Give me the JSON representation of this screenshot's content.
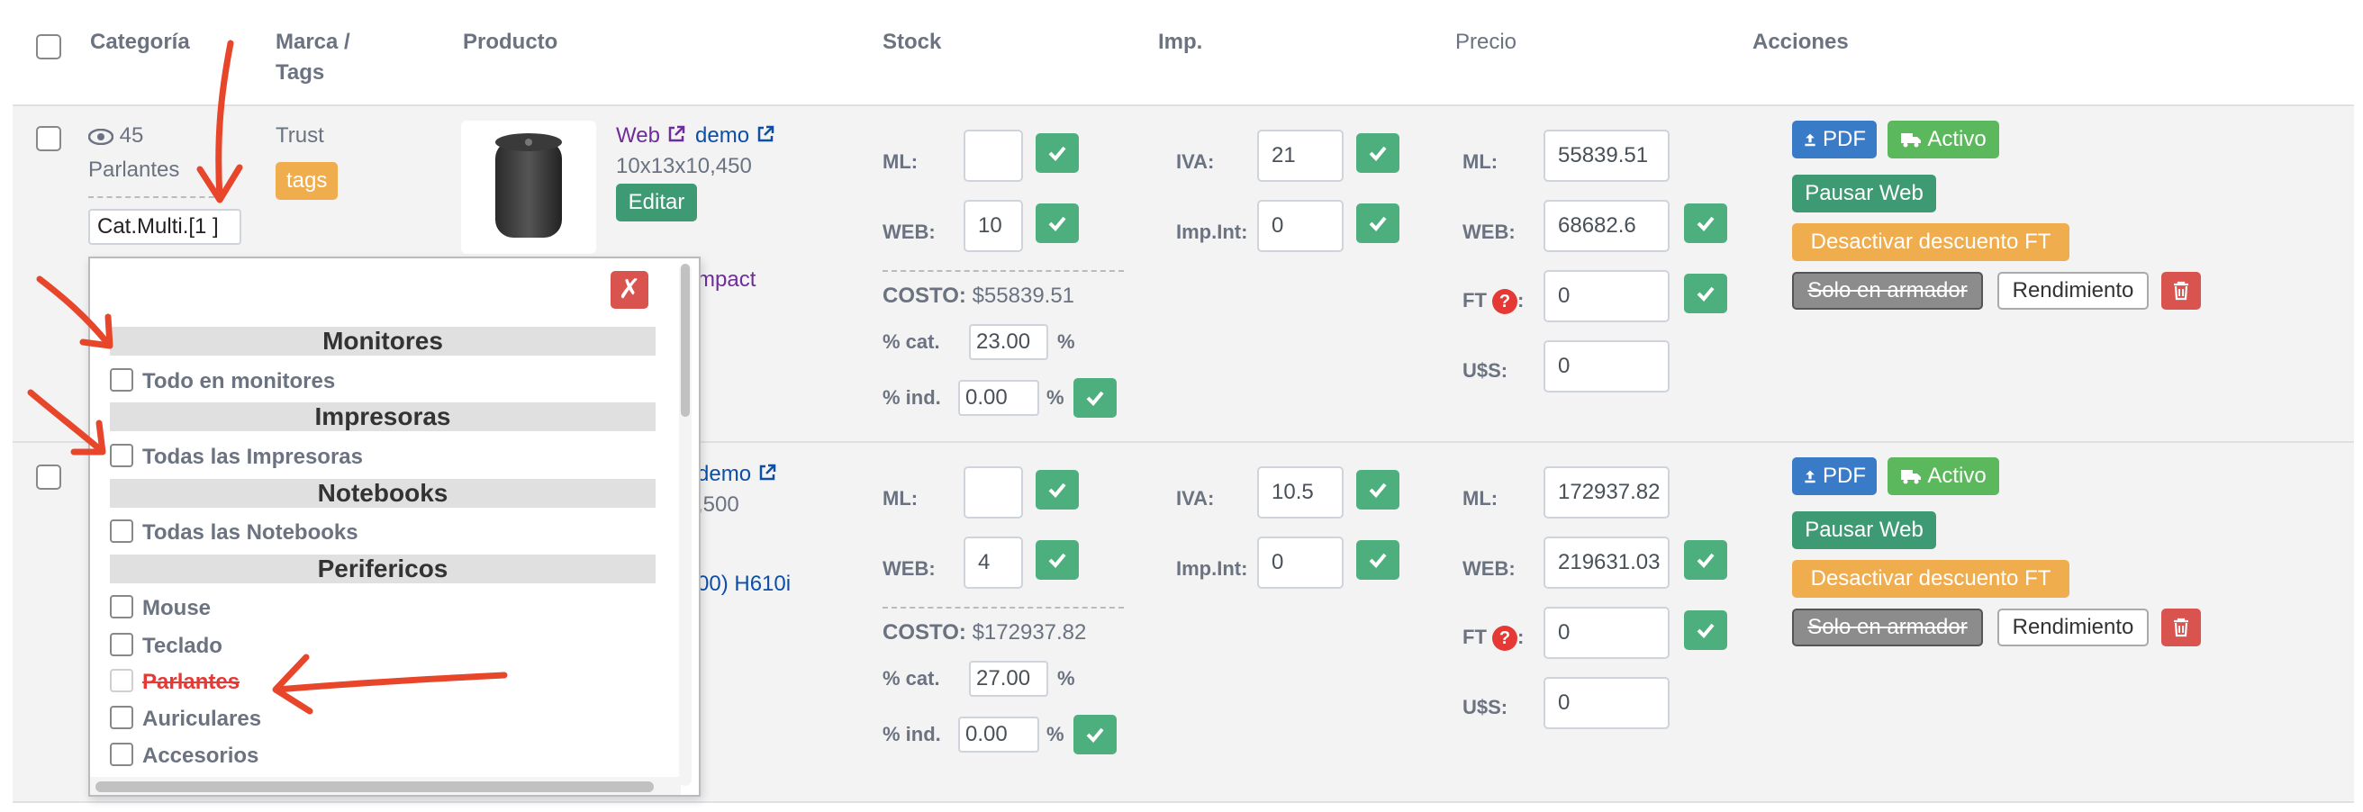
{
  "header": {
    "categoria": "Categoría",
    "marca_line1": "Marca /",
    "marca_line2": "Tags",
    "producto": "Producto",
    "stock": "Stock",
    "imp": "Imp.",
    "precio": "Precio",
    "acciones": "Acciones"
  },
  "row1": {
    "views": "45",
    "categoria": "Parlantes",
    "cat_multi": "Cat.Multi.[1 ]",
    "marca": "Trust",
    "tags_label": "tags",
    "web_link": "Web",
    "demo_link": "demo",
    "dimensiones": "10x13x10,450",
    "editar": "Editar",
    "product_name_fragment": "mpact",
    "stock": {
      "ml_label": "ML:",
      "ml_value": "",
      "web_label": "WEB:",
      "web_value": "10"
    },
    "costo_label": "COSTO:",
    "costo_value": "$55839.51",
    "pct_cat_label": "% cat.",
    "pct_cat_value": "23.00",
    "pct_ind_label": "% ind.",
    "pct_ind_value": "0.00",
    "pct_sign": "%",
    "imp": {
      "iva_label": "IVA:",
      "iva_value": "21",
      "impint_label": "Imp.Int:",
      "impint_value": "0"
    },
    "precio": {
      "ml_label": "ML:",
      "ml_value": "55839.51",
      "web_label": "WEB:",
      "web_value": "68682.6",
      "ft_label": "FT",
      "ft_value": "0",
      "uss_label": "U$S:",
      "uss_value": "0"
    }
  },
  "row2": {
    "demo_link": "demo",
    "dim_fragment": ",500",
    "product_fragment": "00) H610i",
    "stock": {
      "ml_label": "ML:",
      "ml_value": "",
      "web_label": "WEB:",
      "web_value": "4"
    },
    "costo_label": "COSTO:",
    "costo_value": "$172937.82",
    "pct_cat_label": "% cat.",
    "pct_cat_value": "27.00",
    "pct_ind_label": "% ind.",
    "pct_ind_value": "0.00",
    "pct_sign": "%",
    "imp": {
      "iva_label": "IVA:",
      "iva_value": "10.5",
      "impint_label": "Imp.Int:",
      "impint_value": "0"
    },
    "precio": {
      "ml_label": "ML:",
      "ml_value": "172937.82",
      "web_label": "WEB:",
      "web_value": "219631.03",
      "ft_label": "FT",
      "ft_value": "0",
      "uss_label": "U$S:",
      "uss_value": "0"
    }
  },
  "actions": {
    "pdf": "PDF",
    "activo": "Activo",
    "pausar_web": "Pausar Web",
    "desactivar": "Desactivar descuento FT",
    "solo_armador": "Solo en armador",
    "rendimiento": "Rendimiento"
  },
  "ft_help": "?",
  "dropdown": {
    "close_glyph": "✗",
    "groups": [
      {
        "title": "Monitores",
        "options": [
          "Todo en monitores"
        ]
      },
      {
        "title": "Impresoras",
        "options": [
          "Todas las Impresoras"
        ]
      },
      {
        "title": "Notebooks",
        "options": [
          "Todas las Notebooks"
        ]
      },
      {
        "title": "Perifericos",
        "options": [
          "Mouse",
          "Teclado",
          "Parlantes",
          "Auriculares",
          "Accesorios"
        ]
      }
    ]
  },
  "colors": {
    "check_green": "#4caf7d",
    "annotation_red": "#e8462a",
    "blue_btn": "#3a7bc8",
    "orange_btn": "#f0ad4e",
    "teal_btn": "#3e9a72"
  }
}
